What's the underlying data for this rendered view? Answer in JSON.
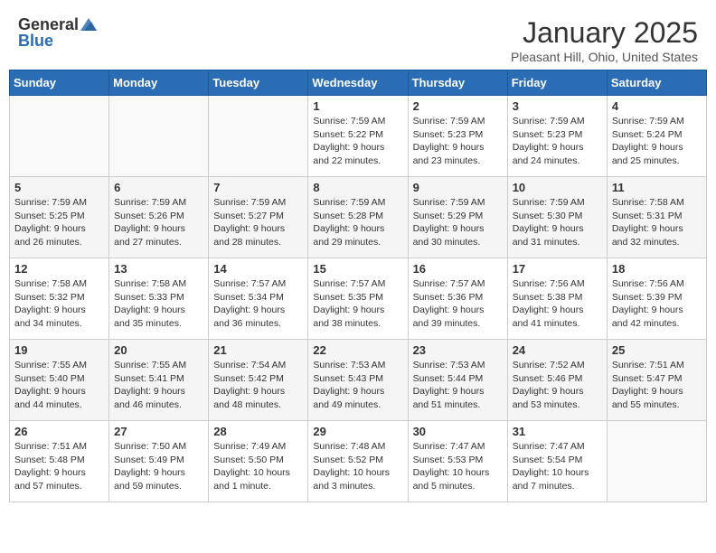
{
  "header": {
    "logo_general": "General",
    "logo_blue": "Blue",
    "month": "January 2025",
    "location": "Pleasant Hill, Ohio, United States"
  },
  "weekdays": [
    "Sunday",
    "Monday",
    "Tuesday",
    "Wednesday",
    "Thursday",
    "Friday",
    "Saturday"
  ],
  "weeks": [
    [
      {
        "day": "",
        "info": ""
      },
      {
        "day": "",
        "info": ""
      },
      {
        "day": "",
        "info": ""
      },
      {
        "day": "1",
        "info": "Sunrise: 7:59 AM\nSunset: 5:22 PM\nDaylight: 9 hours and 22 minutes."
      },
      {
        "day": "2",
        "info": "Sunrise: 7:59 AM\nSunset: 5:23 PM\nDaylight: 9 hours and 23 minutes."
      },
      {
        "day": "3",
        "info": "Sunrise: 7:59 AM\nSunset: 5:23 PM\nDaylight: 9 hours and 24 minutes."
      },
      {
        "day": "4",
        "info": "Sunrise: 7:59 AM\nSunset: 5:24 PM\nDaylight: 9 hours and 25 minutes."
      }
    ],
    [
      {
        "day": "5",
        "info": "Sunrise: 7:59 AM\nSunset: 5:25 PM\nDaylight: 9 hours and 26 minutes."
      },
      {
        "day": "6",
        "info": "Sunrise: 7:59 AM\nSunset: 5:26 PM\nDaylight: 9 hours and 27 minutes."
      },
      {
        "day": "7",
        "info": "Sunrise: 7:59 AM\nSunset: 5:27 PM\nDaylight: 9 hours and 28 minutes."
      },
      {
        "day": "8",
        "info": "Sunrise: 7:59 AM\nSunset: 5:28 PM\nDaylight: 9 hours and 29 minutes."
      },
      {
        "day": "9",
        "info": "Sunrise: 7:59 AM\nSunset: 5:29 PM\nDaylight: 9 hours and 30 minutes."
      },
      {
        "day": "10",
        "info": "Sunrise: 7:59 AM\nSunset: 5:30 PM\nDaylight: 9 hours and 31 minutes."
      },
      {
        "day": "11",
        "info": "Sunrise: 7:58 AM\nSunset: 5:31 PM\nDaylight: 9 hours and 32 minutes."
      }
    ],
    [
      {
        "day": "12",
        "info": "Sunrise: 7:58 AM\nSunset: 5:32 PM\nDaylight: 9 hours and 34 minutes."
      },
      {
        "day": "13",
        "info": "Sunrise: 7:58 AM\nSunset: 5:33 PM\nDaylight: 9 hours and 35 minutes."
      },
      {
        "day": "14",
        "info": "Sunrise: 7:57 AM\nSunset: 5:34 PM\nDaylight: 9 hours and 36 minutes."
      },
      {
        "day": "15",
        "info": "Sunrise: 7:57 AM\nSunset: 5:35 PM\nDaylight: 9 hours and 38 minutes."
      },
      {
        "day": "16",
        "info": "Sunrise: 7:57 AM\nSunset: 5:36 PM\nDaylight: 9 hours and 39 minutes."
      },
      {
        "day": "17",
        "info": "Sunrise: 7:56 AM\nSunset: 5:38 PM\nDaylight: 9 hours and 41 minutes."
      },
      {
        "day": "18",
        "info": "Sunrise: 7:56 AM\nSunset: 5:39 PM\nDaylight: 9 hours and 42 minutes."
      }
    ],
    [
      {
        "day": "19",
        "info": "Sunrise: 7:55 AM\nSunset: 5:40 PM\nDaylight: 9 hours and 44 minutes."
      },
      {
        "day": "20",
        "info": "Sunrise: 7:55 AM\nSunset: 5:41 PM\nDaylight: 9 hours and 46 minutes."
      },
      {
        "day": "21",
        "info": "Sunrise: 7:54 AM\nSunset: 5:42 PM\nDaylight: 9 hours and 48 minutes."
      },
      {
        "day": "22",
        "info": "Sunrise: 7:53 AM\nSunset: 5:43 PM\nDaylight: 9 hours and 49 minutes."
      },
      {
        "day": "23",
        "info": "Sunrise: 7:53 AM\nSunset: 5:44 PM\nDaylight: 9 hours and 51 minutes."
      },
      {
        "day": "24",
        "info": "Sunrise: 7:52 AM\nSunset: 5:46 PM\nDaylight: 9 hours and 53 minutes."
      },
      {
        "day": "25",
        "info": "Sunrise: 7:51 AM\nSunset: 5:47 PM\nDaylight: 9 hours and 55 minutes."
      }
    ],
    [
      {
        "day": "26",
        "info": "Sunrise: 7:51 AM\nSunset: 5:48 PM\nDaylight: 9 hours and 57 minutes."
      },
      {
        "day": "27",
        "info": "Sunrise: 7:50 AM\nSunset: 5:49 PM\nDaylight: 9 hours and 59 minutes."
      },
      {
        "day": "28",
        "info": "Sunrise: 7:49 AM\nSunset: 5:50 PM\nDaylight: 10 hours and 1 minute."
      },
      {
        "day": "29",
        "info": "Sunrise: 7:48 AM\nSunset: 5:52 PM\nDaylight: 10 hours and 3 minutes."
      },
      {
        "day": "30",
        "info": "Sunrise: 7:47 AM\nSunset: 5:53 PM\nDaylight: 10 hours and 5 minutes."
      },
      {
        "day": "31",
        "info": "Sunrise: 7:47 AM\nSunset: 5:54 PM\nDaylight: 10 hours and 7 minutes."
      },
      {
        "day": "",
        "info": ""
      }
    ]
  ]
}
